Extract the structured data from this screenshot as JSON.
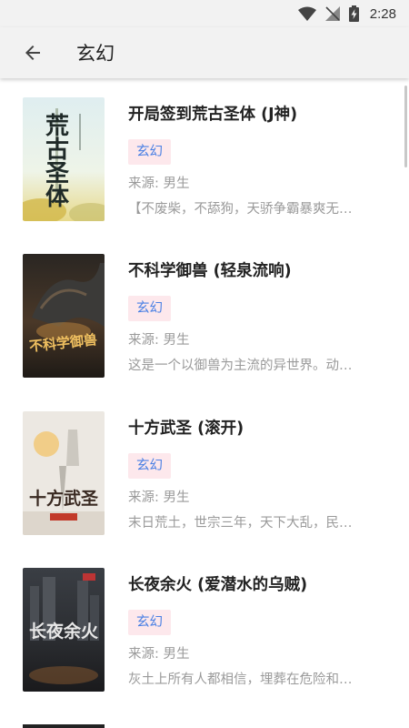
{
  "status_bar": {
    "time": "2:28"
  },
  "app_bar": {
    "title": "玄幻"
  },
  "books": [
    {
      "title": "开局签到荒古圣体 (J神)",
      "tag": "玄幻",
      "source": "来源: 男生",
      "intro": "【不废柴，不舔狗，天骄争霸暴爽无…",
      "cover_text": "荒古圣体"
    },
    {
      "title": "不科学御兽 (轻泉流响)",
      "tag": "玄幻",
      "source": "来源: 男生",
      "intro": "这是一个以御兽为主流的异世界。动…",
      "cover_text": "不科学御兽"
    },
    {
      "title": "十方武圣 (滚开)",
      "tag": "玄幻",
      "source": "来源: 男生",
      "intro": "末日荒土，世宗三年，天下大乱，民…",
      "cover_text": "十方武圣"
    },
    {
      "title": "长夜余火 (爱潜水的乌贼)",
      "tag": "玄幻",
      "source": "来源: 男生",
      "intro": "灰土上所有人都相信，埋葬在危险和…",
      "cover_text": "长夜余火"
    }
  ]
}
